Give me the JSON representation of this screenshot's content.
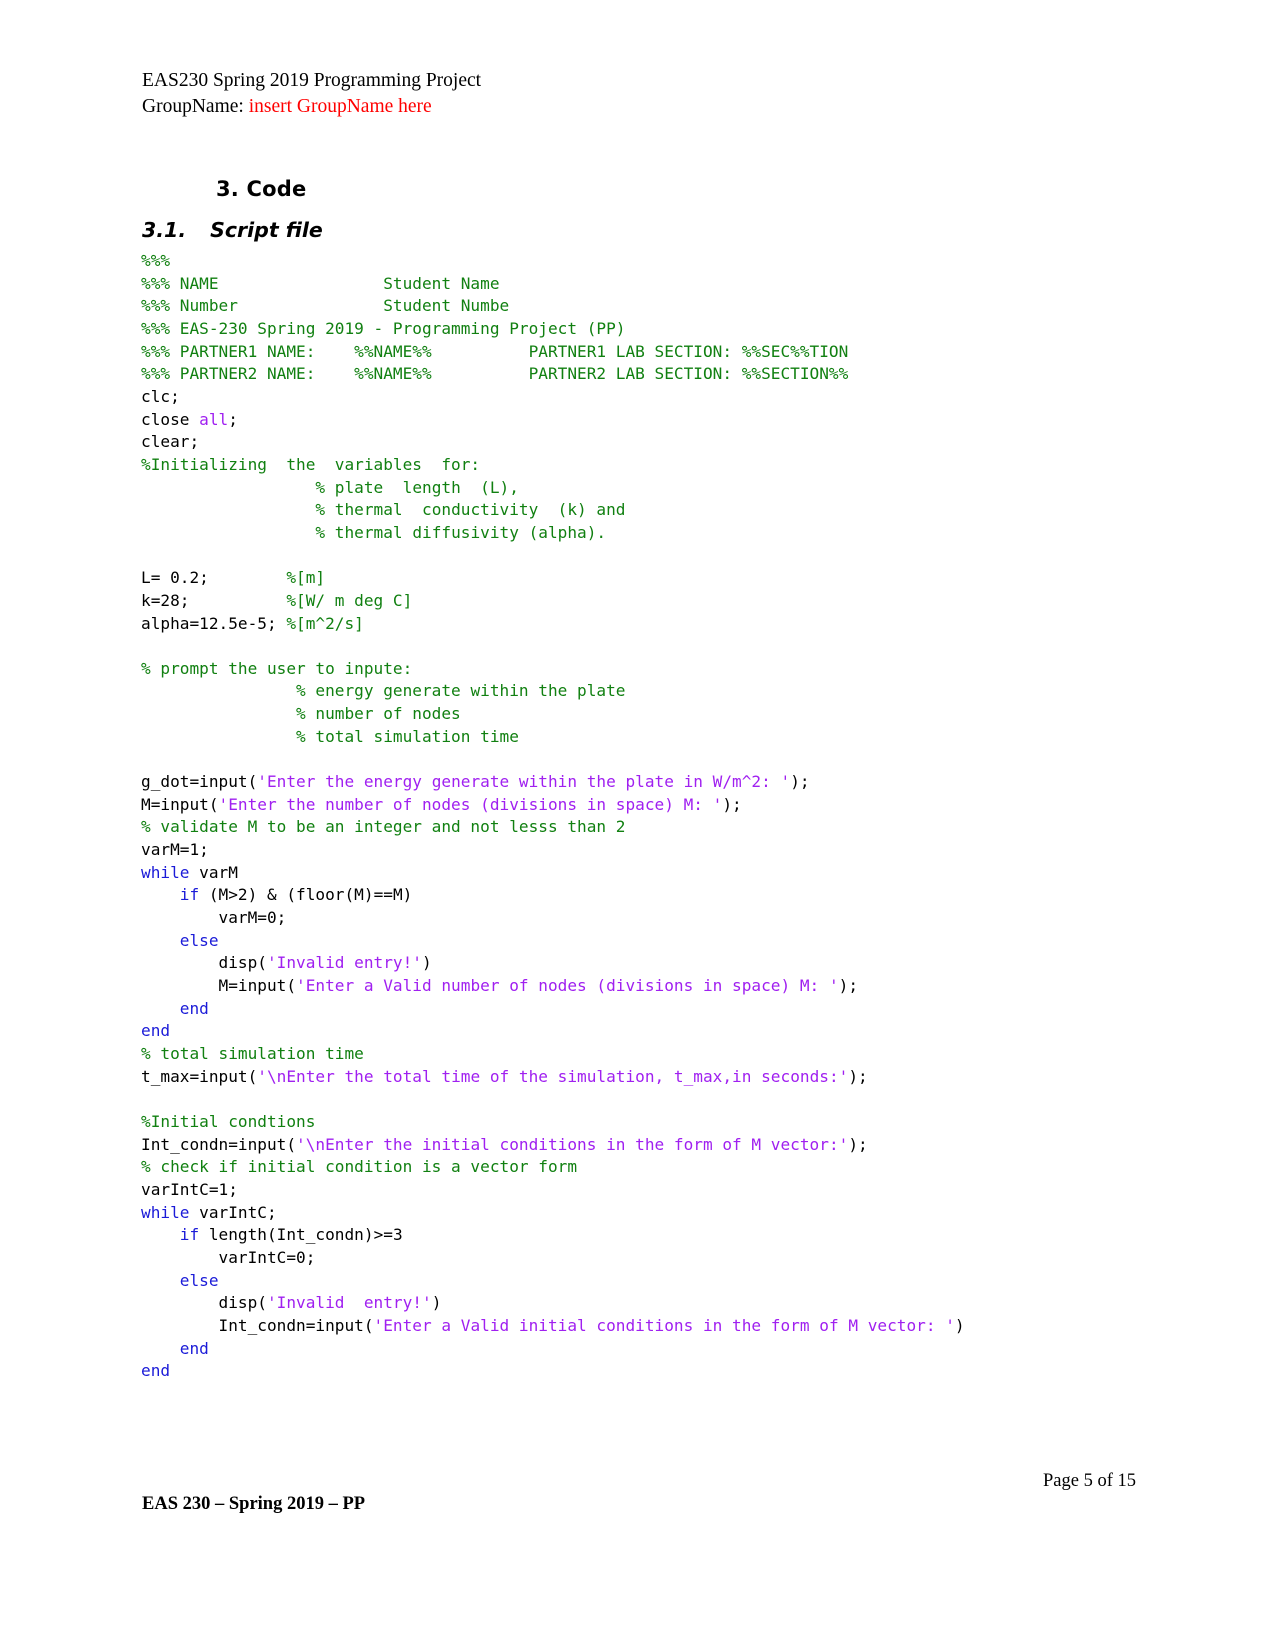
{
  "header": {
    "title_line": "EAS230 Spring 2019 Programming Project",
    "group_label": "GroupName: ",
    "group_value": "insert GroupName here"
  },
  "headings": {
    "section": "3. Code",
    "subsection_number": "3.1.",
    "subsection_title": "Script file"
  },
  "colors": {
    "comment": "#118011",
    "keyword": "#1b1bd8",
    "string": "#a020f0",
    "plain": "#000000",
    "accent_red": "#ff0000"
  },
  "code": {
    "language": "MATLAB",
    "lines": [
      [
        {
          "t": "%%%",
          "c": "cm"
        }
      ],
      [
        {
          "t": "%%% NAME                 Student Name",
          "c": "cm"
        }
      ],
      [
        {
          "t": "%%% Number               Student Numbe",
          "c": "cm"
        }
      ],
      [
        {
          "t": "%%% EAS-230 Spring 2019 - Programming Project (PP)",
          "c": "cm"
        }
      ],
      [
        {
          "t": "%%% PARTNER1 NAME:    %%NAME%%          PARTNER1 LAB SECTION: %%SEC%%TION",
          "c": "cm"
        }
      ],
      [
        {
          "t": "%%% PARTNER2 NAME:    %%NAME%%          PARTNER2 LAB SECTION: %%SECTION%%",
          "c": "cm"
        }
      ],
      [
        {
          "t": "clc;",
          "c": "pl"
        }
      ],
      [
        {
          "t": "close ",
          "c": "pl"
        },
        {
          "t": "all",
          "c": "str"
        },
        {
          "t": ";",
          "c": "pl"
        }
      ],
      [
        {
          "t": "clear;",
          "c": "pl"
        }
      ],
      [
        {
          "t": "%Initializing  the  variables  for:",
          "c": "cm"
        }
      ],
      [
        {
          "t": "                  % plate  length  (L),",
          "c": "cm"
        }
      ],
      [
        {
          "t": "                  % thermal  conductivity  (k) and",
          "c": "cm"
        }
      ],
      [
        {
          "t": "                  % thermal diffusivity (alpha).",
          "c": "cm"
        }
      ],
      [
        {
          "t": "",
          "c": "pl"
        }
      ],
      [
        {
          "t": "L= 0.2;        ",
          "c": "pl"
        },
        {
          "t": "%[m]",
          "c": "cm"
        }
      ],
      [
        {
          "t": "k=28;          ",
          "c": "pl"
        },
        {
          "t": "%[W/ m deg C]",
          "c": "cm"
        }
      ],
      [
        {
          "t": "alpha=12.5e-5; ",
          "c": "pl"
        },
        {
          "t": "%[m^2/s]",
          "c": "cm"
        }
      ],
      [
        {
          "t": "",
          "c": "pl"
        }
      ],
      [
        {
          "t": "% prompt the user to inpute:",
          "c": "cm"
        }
      ],
      [
        {
          "t": "                % energy generate within the plate",
          "c": "cm"
        }
      ],
      [
        {
          "t": "                % number of nodes",
          "c": "cm"
        }
      ],
      [
        {
          "t": "                % total simulation time",
          "c": "cm"
        }
      ],
      [
        {
          "t": "",
          "c": "pl"
        }
      ],
      [
        {
          "t": "g_dot=input(",
          "c": "pl"
        },
        {
          "t": "'Enter the energy generate within the plate in W/m^2: '",
          "c": "str"
        },
        {
          "t": ");",
          "c": "pl"
        }
      ],
      [
        {
          "t": "M=input(",
          "c": "pl"
        },
        {
          "t": "'Enter the number of nodes (divisions in space) M: '",
          "c": "str"
        },
        {
          "t": ");",
          "c": "pl"
        }
      ],
      [
        {
          "t": "% validate M to be an integer and not lesss than 2",
          "c": "cm"
        }
      ],
      [
        {
          "t": "varM=1;",
          "c": "pl"
        }
      ],
      [
        {
          "t": "while",
          "c": "kw"
        },
        {
          "t": " varM",
          "c": "pl"
        }
      ],
      [
        {
          "t": "    ",
          "c": "pl"
        },
        {
          "t": "if",
          "c": "kw"
        },
        {
          "t": " (M>2) & (floor(M)==M)",
          "c": "pl"
        }
      ],
      [
        {
          "t": "        varM=0;",
          "c": "pl"
        }
      ],
      [
        {
          "t": "    ",
          "c": "pl"
        },
        {
          "t": "else",
          "c": "kw"
        }
      ],
      [
        {
          "t": "        disp(",
          "c": "pl"
        },
        {
          "t": "'Invalid entry!'",
          "c": "str"
        },
        {
          "t": ")",
          "c": "pl"
        }
      ],
      [
        {
          "t": "        M=input(",
          "c": "pl"
        },
        {
          "t": "'Enter a Valid number of nodes (divisions in space) M: '",
          "c": "str"
        },
        {
          "t": ");",
          "c": "pl"
        }
      ],
      [
        {
          "t": "    ",
          "c": "pl"
        },
        {
          "t": "end",
          "c": "kw"
        }
      ],
      [
        {
          "t": "end",
          "c": "kw"
        }
      ],
      [
        {
          "t": "% total simulation time",
          "c": "cm"
        }
      ],
      [
        {
          "t": "t_max=input(",
          "c": "pl"
        },
        {
          "t": "'\\nEnter the total time of the simulation, t_max,in seconds:'",
          "c": "str"
        },
        {
          "t": ");",
          "c": "pl"
        }
      ],
      [
        {
          "t": "",
          "c": "pl"
        }
      ],
      [
        {
          "t": "%Initial condtions",
          "c": "cm"
        }
      ],
      [
        {
          "t": "Int_condn=input(",
          "c": "pl"
        },
        {
          "t": "'\\nEnter the initial conditions in the form of M vector:'",
          "c": "str"
        },
        {
          "t": ");",
          "c": "pl"
        }
      ],
      [
        {
          "t": "% check if initial condition is a vector form",
          "c": "cm"
        }
      ],
      [
        {
          "t": "varIntC=1;",
          "c": "pl"
        }
      ],
      [
        {
          "t": "while",
          "c": "kw"
        },
        {
          "t": " varIntC;",
          "c": "pl"
        }
      ],
      [
        {
          "t": "    ",
          "c": "pl"
        },
        {
          "t": "if",
          "c": "kw"
        },
        {
          "t": " length(Int_condn)>=3",
          "c": "pl"
        }
      ],
      [
        {
          "t": "        varIntC=0;",
          "c": "pl"
        }
      ],
      [
        {
          "t": "    ",
          "c": "pl"
        },
        {
          "t": "else",
          "c": "kw"
        }
      ],
      [
        {
          "t": "        disp(",
          "c": "pl"
        },
        {
          "t": "'Invalid  entry!'",
          "c": "str"
        },
        {
          "t": ")",
          "c": "pl"
        }
      ],
      [
        {
          "t": "        Int_condn=input(",
          "c": "pl"
        },
        {
          "t": "'Enter a Valid initial conditions in the form of M vector: '",
          "c": "str"
        },
        {
          "t": ")",
          "c": "pl"
        }
      ],
      [
        {
          "t": "    ",
          "c": "pl"
        },
        {
          "t": "end",
          "c": "kw"
        }
      ],
      [
        {
          "t": "end",
          "c": "kw"
        }
      ]
    ]
  },
  "footer": {
    "page_label": "Page 5 of 15",
    "course_label": "EAS 230 – Spring 2019 – PP"
  }
}
